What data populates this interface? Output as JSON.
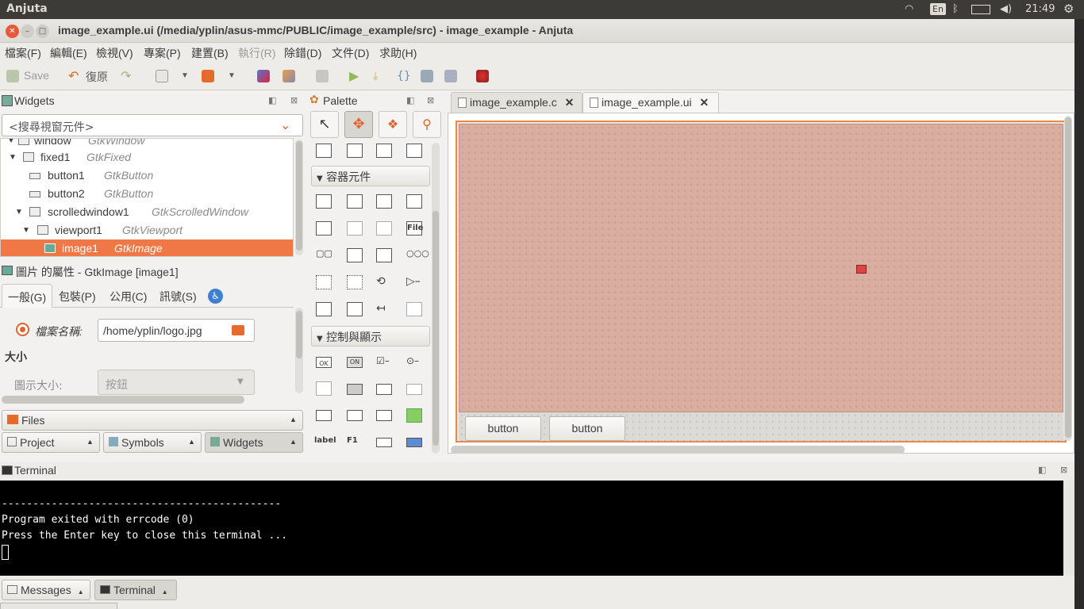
{
  "top_panel": {
    "app_name": "Anjuta",
    "keyboard": "En",
    "clock": "21:49"
  },
  "window": {
    "title": "image_example.ui (/media/yplin/asus-mmc/PUBLIC/image_example/src) - image_example - Anjuta"
  },
  "menu": [
    "檔案(F)",
    "編輯(E)",
    "檢視(V)",
    "專案(P)",
    "建置(B)",
    "執行(R)",
    "除錯(D)",
    "文件(D)",
    "求助(H)"
  ],
  "toolbar": {
    "save_label": "Save",
    "revert_label": "復原"
  },
  "widgets_panel": {
    "title": "Widgets",
    "search_placeholder": "<搜尋視窗元件>",
    "tree": [
      {
        "name": "window",
        "type": "GtkWindow"
      },
      {
        "name": "fixed1",
        "type": "GtkFixed"
      },
      {
        "name": "button1",
        "type": "GtkButton"
      },
      {
        "name": "button2",
        "type": "GtkButton"
      },
      {
        "name": "scrolledwindow1",
        "type": "GtkScrolledWindow"
      },
      {
        "name": "viewport1",
        "type": "GtkViewport"
      },
      {
        "name": "image1",
        "type": "GtkImage"
      }
    ]
  },
  "properties": {
    "title": "圖片 的屬性 - GtkImage [image1]",
    "tabs": [
      "一般(G)",
      "包裝(P)",
      "公用(C)",
      "訊號(S)"
    ],
    "filename_label": "檔案名稱:",
    "filename_value": "/home/yplin/logo.jpg",
    "size_section": "大小",
    "icon_size_label": "圖示大小:",
    "icon_size_value": "按鈕"
  },
  "side_tabs": {
    "files": "Files",
    "project": "Project",
    "symbols": "Symbols",
    "widgets": "Widgets"
  },
  "palette": {
    "title": "Palette",
    "containers": "容器元件",
    "controls": "控制與顯示",
    "file_label": "File",
    "label_text": "label",
    "ok_text": "OK",
    "on_text": "ON",
    "f1_text": "F1"
  },
  "doc_tabs": [
    "image_example.c",
    "image_example.ui"
  ],
  "designer": {
    "button1_label": "button",
    "button2_label": "button"
  },
  "terminal": {
    "title": "Terminal",
    "lines": [
      "",
      "---------------------------------------------",
      "Program exited with errcode (0)",
      "Press the Enter key to close this terminal ..."
    ]
  },
  "bottom_tabs": {
    "messages": "Messages",
    "terminal": "Terminal"
  },
  "colors": {
    "selection": "#f07746",
    "panel": "#3c3b37",
    "canvas": "#d9aea0"
  }
}
